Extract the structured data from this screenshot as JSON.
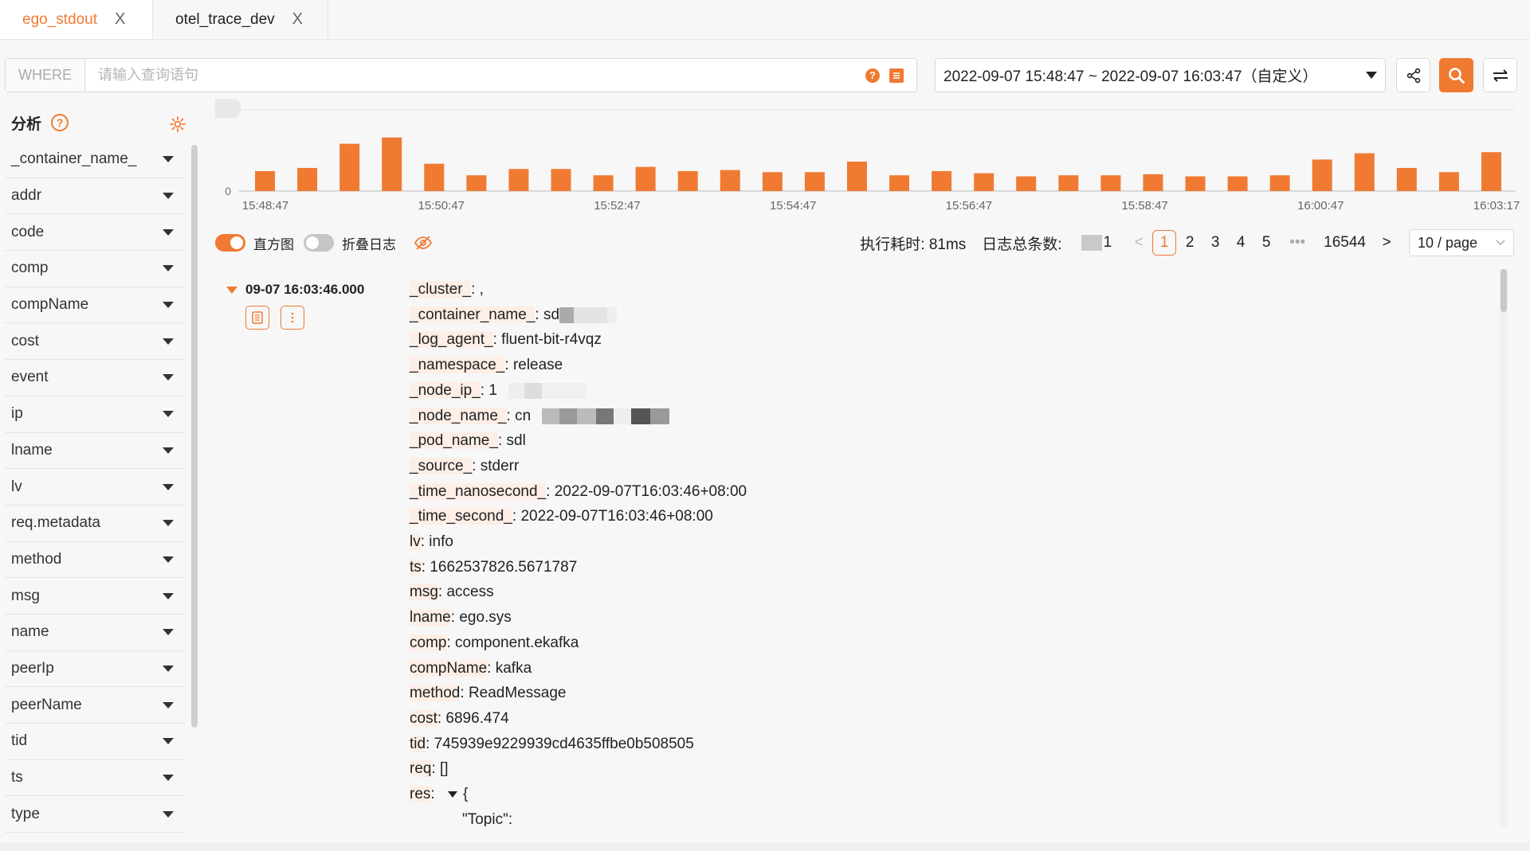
{
  "tabs": [
    {
      "label": "ego_stdout",
      "close": "X"
    },
    {
      "label": "otel_trace_dev",
      "close": "X"
    }
  ],
  "query": {
    "where_label": "WHERE",
    "placeholder": "请输入查询语句",
    "help_icon": "?"
  },
  "time_range": {
    "value": "2022-09-07 15:48:47 ~ 2022-09-07 16:03:47（自定义）"
  },
  "toolbar": {
    "share_icon": "share-icon",
    "search_icon": "search-icon",
    "swap_icon": "swap-icon"
  },
  "sidebar": {
    "title": "分析",
    "help": "?",
    "fields": [
      "_container_name_",
      "addr",
      "code",
      "comp",
      "compName",
      "cost",
      "event",
      "ip",
      "lname",
      "lv",
      "req.metadata",
      "method",
      "msg",
      "name",
      "peerIp",
      "peerName",
      "tid",
      "ts",
      "type"
    ]
  },
  "chart_data": {
    "type": "bar",
    "color": "#f07a32",
    "ylim": [
      0,
      5
    ],
    "y_tick_labels": [
      "0"
    ],
    "x_tick_labels": [
      "15:48:47",
      "15:50:47",
      "15:52:47",
      "15:54:47",
      "15:56:47",
      "15:58:47",
      "16:00:47",
      "16:03:17"
    ],
    "values": [
      1.9,
      2.2,
      4.5,
      5.1,
      2.6,
      1.5,
      2.1,
      2.1,
      1.5,
      2.3,
      1.9,
      2.0,
      1.8,
      1.8,
      2.8,
      1.5,
      1.9,
      1.7,
      1.4,
      1.5,
      1.5,
      1.6,
      1.4,
      1.4,
      1.5,
      3.0,
      3.6,
      2.2,
      1.8,
      3.7
    ]
  },
  "controls": {
    "histogram_label": "直方图",
    "fold_label": "折叠日志",
    "elapsed": "执行耗时: 81ms",
    "total_label": "日志总条数:",
    "total_suffix": "1",
    "prev": "<",
    "pages": [
      "1",
      "2",
      "3",
      "4",
      "5"
    ],
    "ellipsis": "•••",
    "last_page": "16544",
    "next": ">",
    "page_size": "10 / page"
  },
  "log": {
    "timestamp": "09-07 16:03:46.000",
    "fields": [
      {
        "k": "_cluster_",
        "v": "        ,"
      },
      {
        "k": "_container_name_",
        "v": "sd"
      },
      {
        "k": "_log_agent_",
        "v": "fluent-bit-r4vqz"
      },
      {
        "k": "_namespace_",
        "v": "release"
      },
      {
        "k": "_node_ip_",
        "v": "1"
      },
      {
        "k": "_node_name_",
        "v": "cn"
      },
      {
        "k": "_pod_name_",
        "v": "sdl"
      },
      {
        "k": "_source_",
        "v": "stderr"
      },
      {
        "k": "_time_nanosecond_",
        "v": "2022-09-07T16:03:46+08:00"
      },
      {
        "k": "_time_second_",
        "v": "2022-09-07T16:03:46+08:00"
      },
      {
        "k": "lv",
        "v": "info"
      },
      {
        "k": "ts",
        "v": "1662537826.5671787"
      },
      {
        "k": "msg",
        "v": "access"
      },
      {
        "k": "lname",
        "v": "ego.sys"
      },
      {
        "k": "comp",
        "v": "component.ekafka"
      },
      {
        "k": "compName",
        "v": "kafka"
      },
      {
        "k": "method",
        "v": "ReadMessage"
      },
      {
        "k": "cost",
        "v": "6896.474"
      },
      {
        "k": "tid",
        "v": "745939e9229939cd4635ffbe0b508505"
      },
      {
        "k": "req",
        "v": "[]"
      },
      {
        "k": "res",
        "v": "{"
      }
    ],
    "nested_line": "\"Topic\":"
  }
}
